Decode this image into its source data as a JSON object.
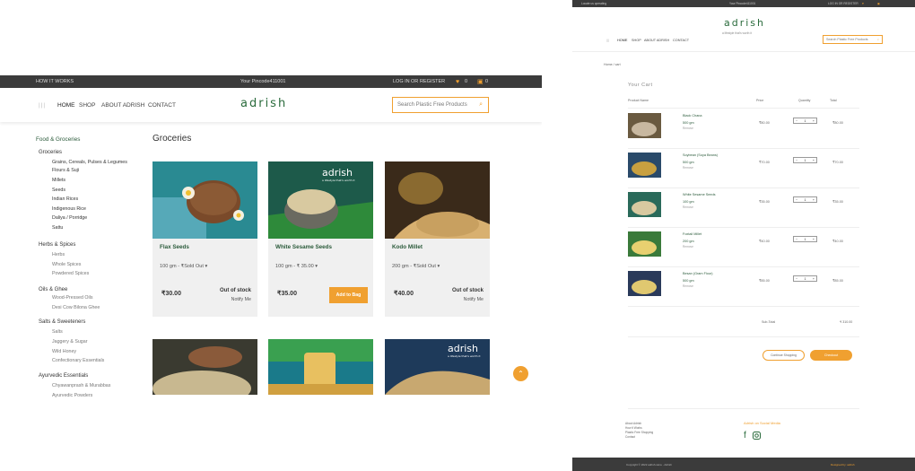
{
  "left": {
    "topbar": {
      "how_it_works": "HOW IT WORKS",
      "pincode": "Your Pincode411001",
      "login": "LOG IN",
      "or": "OR",
      "register": "REGISTER",
      "wishlist_count": "0",
      "cart_count": "0"
    },
    "nav": {
      "home": "HOME",
      "shop": "SHOP",
      "about": "ABOUT ADRISH",
      "contact": "CONTACT"
    },
    "logo": "adrish",
    "search_placeholder": "Search Plastic Free Products",
    "sidebar": {
      "root": "Food & Groceries",
      "items": [
        {
          "label": "Groceries",
          "level": "h"
        },
        {
          "label": "Grains, Cereals, Pulses & Legumes",
          "level": "sub1"
        },
        {
          "label": "Flours & Suji",
          "level": "sub1"
        },
        {
          "label": "Millets",
          "level": "sub1"
        },
        {
          "label": "Seeds",
          "level": "sub1"
        },
        {
          "label": "Indian Rices",
          "level": "sub1"
        },
        {
          "label": "Indigenous Rice",
          "level": "sub1"
        },
        {
          "label": "Daliya / Porridge",
          "level": "sub1"
        },
        {
          "label": "Sattu",
          "level": "sub1"
        },
        {
          "label": "Herbs & Spices",
          "level": "h"
        },
        {
          "label": "Herbs",
          "level": "sub"
        },
        {
          "label": "Whole Spices",
          "level": "sub"
        },
        {
          "label": "Powdered Spices",
          "level": "sub"
        },
        {
          "label": "Oils & Ghee",
          "level": "h"
        },
        {
          "label": "Wood-Pressed Oils",
          "level": "sub"
        },
        {
          "label": "Desi Cow Bilona Ghee",
          "level": "sub"
        },
        {
          "label": "Salts & Sweeteners",
          "level": "h"
        },
        {
          "label": "Salts",
          "level": "sub"
        },
        {
          "label": "Jaggery & Sugar",
          "level": "sub"
        },
        {
          "label": "Wild Honey",
          "level": "sub"
        },
        {
          "label": "Confectionary Essentials",
          "level": "sub"
        },
        {
          "label": "Ayurvedic Essentials",
          "level": "h"
        },
        {
          "label": "Chyawanprash & Murabbas",
          "level": "sub"
        },
        {
          "label": "Ayurvedic Powders",
          "level": "sub"
        }
      ]
    },
    "page_title": "Groceries",
    "products": [
      {
        "name": "Flax Seeds",
        "variant": "100 gm - ₹Sold Out",
        "price": "₹30.00",
        "status": "Out of stock",
        "notify": "Notify Me",
        "button": ""
      },
      {
        "name": "White Sesame Seeds",
        "variant": "100 gm - ₹ 35.00",
        "price": "₹35.00",
        "status": "",
        "notify": "",
        "button": "Add to Bag"
      },
      {
        "name": "Kodo Millet",
        "variant": "200 gm - ₹Sold Out",
        "price": "₹40.00",
        "status": "Out of stock",
        "notify": "Notify Me",
        "button": ""
      }
    ],
    "banner_brand": "adrish",
    "banner_tagline": "a lifestyle that's worth it"
  },
  "right": {
    "topbar_left": "Locate us operating",
    "topbar_mid": "Your Pincode411001",
    "topbar_right": "LOG IN  OR  REGISTER",
    "logo": "adrish",
    "tagline": "a lifestyle that's worth it",
    "nav": {
      "home": "HOME",
      "shop": "SHOP",
      "about": "ABOUT ADRISH",
      "contact": "CONTACT"
    },
    "search_placeholder": "Search Plastic Free Products",
    "breadcrumb": "Home / cart",
    "cart_title": "Your Cart",
    "headers": {
      "product": "Product Name",
      "price": "Price",
      "quantity": "Quantity",
      "total": "Total"
    },
    "items": [
      {
        "name": "Black Chana",
        "size": "500 gm",
        "remove": "Remove",
        "price": "₹80.00",
        "qty": "1",
        "total": "₹80.00"
      },
      {
        "name": "Soybean (Soya Beans)",
        "size": "500 gm",
        "remove": "Remove",
        "price": "₹70.00",
        "qty": "1",
        "total": "₹70.00"
      },
      {
        "name": "White Sesame Seeds",
        "size": "100 gm",
        "remove": "Remove",
        "price": "₹35.00",
        "qty": "1",
        "total": "₹35.00"
      },
      {
        "name": "Foxtail Millet",
        "size": "200 gm",
        "remove": "Remove",
        "price": "₹40.00",
        "qty": "1",
        "total": "₹40.00"
      },
      {
        "name": "Besan (Gram Flour)",
        "size": "500 gm",
        "remove": "Remove",
        "price": "₹85.00",
        "qty": "1",
        "total": "₹85.00"
      }
    ],
    "subtotal_label": "Sub-Total",
    "subtotal_value": "₹ 310.00",
    "continue_label": "Continue Shopping",
    "checkout_label": "Checkout",
    "footer_links": [
      "About Adrish",
      "How it Works",
      "Plastic Free Shopping",
      "Contact"
    ],
    "social_heading": "Adrish on Social Media",
    "copyright": "Copyright © 2022 adrish.store - Adrish",
    "credit": "Designed by: adrish"
  },
  "colors": {
    "accent": "#f0a030",
    "brand_green": "#2a6b3c",
    "dark_bar": "#3b3b3b"
  }
}
